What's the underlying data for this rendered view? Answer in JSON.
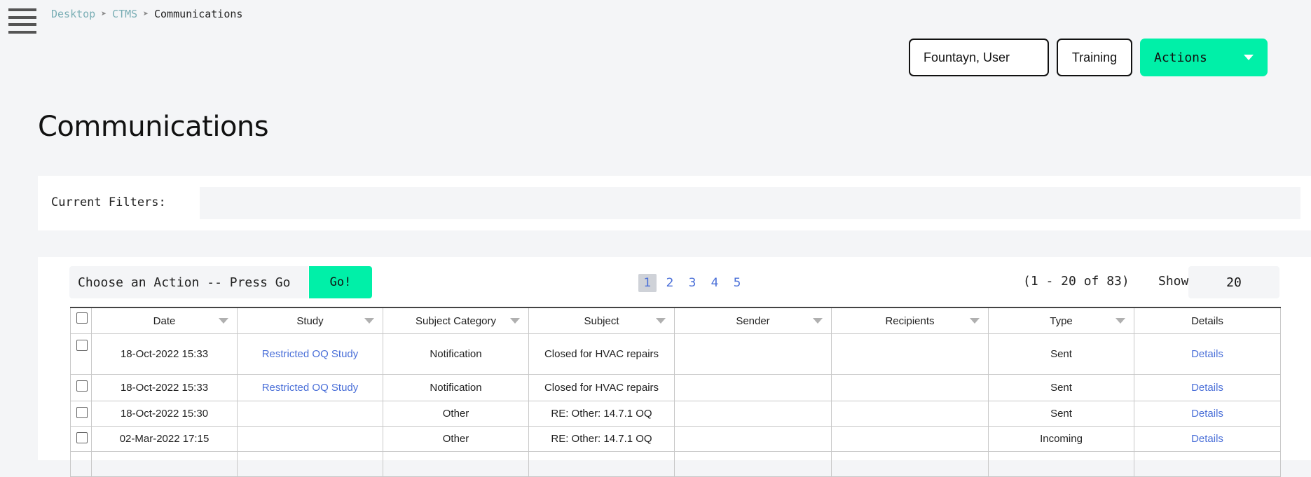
{
  "breadcrumb": {
    "items": [
      "Desktop",
      "CTMS"
    ],
    "current": "Communications"
  },
  "header": {
    "user_label": "Fountayn, User",
    "training_label": "Training",
    "actions_label": "Actions"
  },
  "page": {
    "title": "Communications"
  },
  "filters": {
    "label": "Current Filters:",
    "value": ""
  },
  "toolbar": {
    "action_select_value": "Choose an Action -- Press Go",
    "go_label": "Go!",
    "pages": [
      "1",
      "2",
      "3",
      "4",
      "5"
    ],
    "current_page": "1",
    "range_text": "(1 - 20 of 83)",
    "show_label": "Show",
    "show_value": "20"
  },
  "table": {
    "columns": [
      "Date",
      "Study",
      "Subject Category",
      "Subject",
      "Sender",
      "Recipients",
      "Type",
      "Details"
    ],
    "rows": [
      {
        "date": "18-Oct-2022 15:33",
        "study": "Restricted OQ Study",
        "category": "Notification",
        "subject": "Closed for HVAC repairs",
        "sender": "",
        "recipients": "",
        "type": "Sent",
        "details": "Details"
      },
      {
        "date": "18-Oct-2022 15:33",
        "study": "Restricted OQ Study",
        "category": "Notification",
        "subject": "Closed for HVAC repairs",
        "sender": "",
        "recipients": "",
        "type": "Sent",
        "details": "Details"
      },
      {
        "date": "18-Oct-2022 15:30",
        "study": "",
        "category": "Other",
        "subject": "RE: Other: 14.7.1 OQ",
        "sender": "",
        "recipients": "",
        "type": "Sent",
        "details": "Details"
      },
      {
        "date": "02-Mar-2022 17:15",
        "study": "",
        "category": "Other",
        "subject": "RE: Other: 14.7.1 OQ",
        "sender": "",
        "recipients": "",
        "type": "Incoming",
        "details": "Details"
      },
      {
        "date": "",
        "study": "",
        "category": "",
        "subject": "",
        "sender": "",
        "recipients": "",
        "type": "",
        "details": ""
      }
    ]
  },
  "icons": {
    "menu": "hamburger-icon",
    "breadcrumb_separator": "arrowhead-icon",
    "dropdown": "caret-down-icon",
    "sort": "sort-triangle-icon"
  },
  "colors": {
    "accent": "#00f0a8",
    "link": "#4a6fd8",
    "breadcrumb_link": "#7aaeb5",
    "background": "#f4f5f7"
  }
}
